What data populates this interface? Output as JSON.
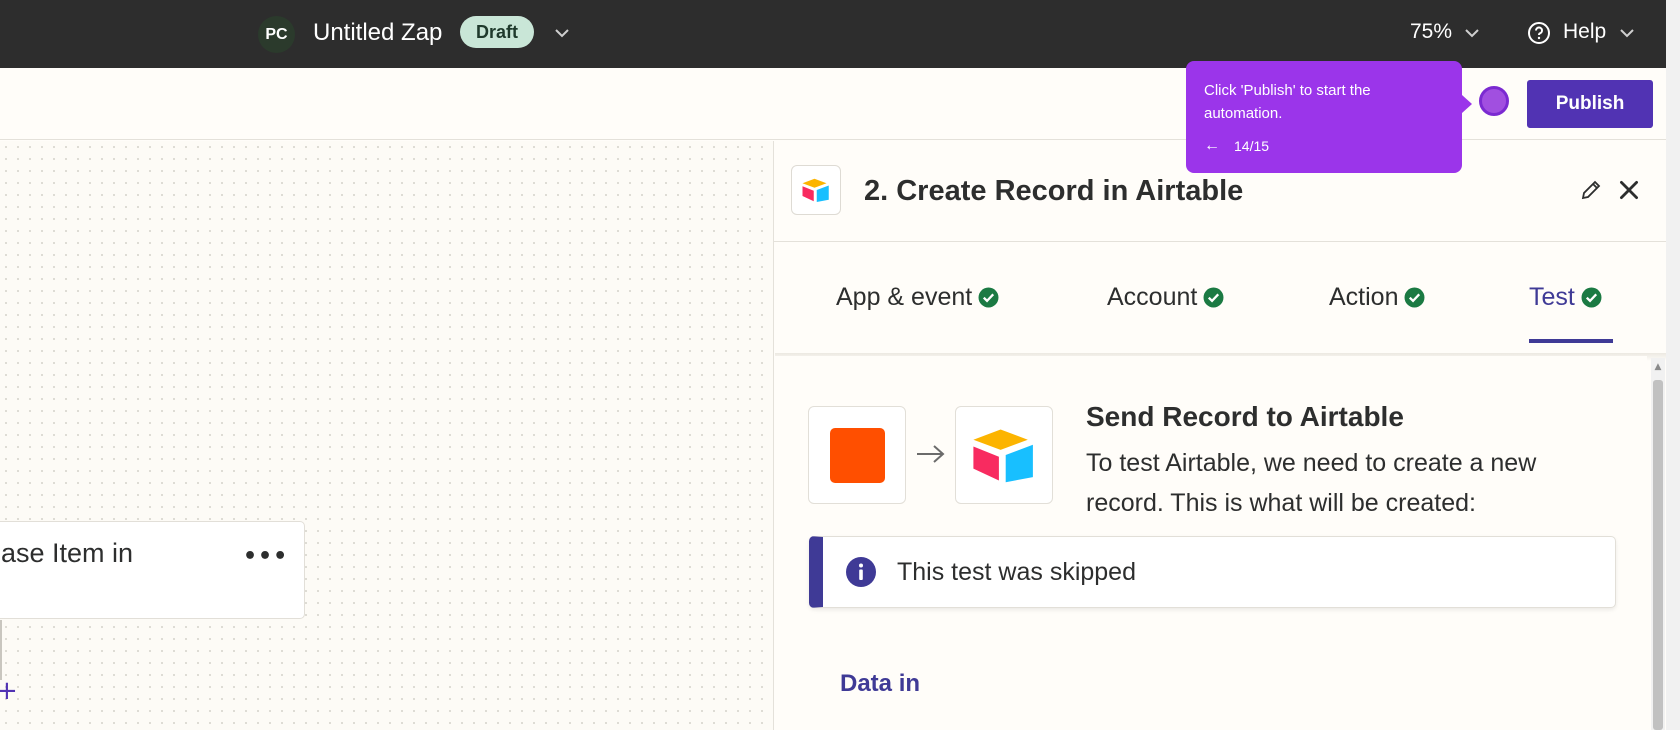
{
  "topbar": {
    "avatar_initials": "PC",
    "zap_title": "Untitled Zap",
    "status_badge": "Draft",
    "zoom": "75%",
    "help_label": "Help"
  },
  "toolbar": {
    "publish_label": "Publish"
  },
  "tooltip": {
    "text": "Click 'Publish' to start the automation.",
    "step_counter": "14/15",
    "back_arrow": "←"
  },
  "canvas": {
    "step_card_title": "ase Item in",
    "more_icon": "•••",
    "add_icon": "+"
  },
  "panel": {
    "title": "2. Create Record in Airtable",
    "tabs": [
      {
        "label": "App & event",
        "complete": true
      },
      {
        "label": "Account",
        "complete": true
      },
      {
        "label": "Action",
        "complete": true
      },
      {
        "label": "Test",
        "complete": true,
        "active": true
      }
    ],
    "send_title": "Send Record to Airtable",
    "send_description": "To test Airtable, we need to create a new record. This is what will be created:",
    "info_message": "This test was skipped",
    "data_in_label": "Data in"
  },
  "colors": {
    "topbar_bg": "#2d2d2d",
    "publish_bg": "#5133b3",
    "tooltip_bg": "#9b35ea",
    "active_tab": "#3f3a96",
    "check_green": "#1b7a43",
    "source_app": "#ff4f00",
    "draft_badge": "#c9e6d7"
  },
  "icons": {
    "chevron": "chevron-down-icon",
    "help": "help-circle-icon",
    "edit": "pencil-icon",
    "close": "close-icon",
    "check": "check-circle-icon",
    "info": "info-icon",
    "airtable": "airtable-logo-icon"
  }
}
